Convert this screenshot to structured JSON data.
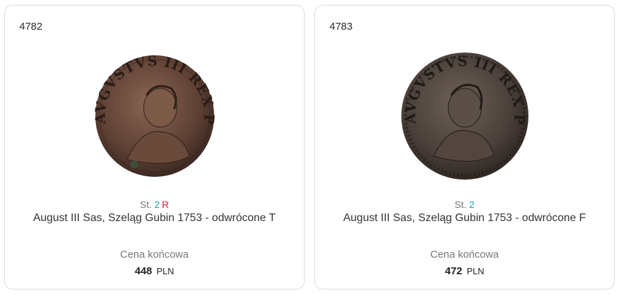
{
  "items": [
    {
      "lot": "4782",
      "grade_prefix": "St.",
      "grade_value": "2",
      "rarity": "R",
      "title": "August III Sas, Szeląg Gubin 1753 - odwrócone T",
      "price_label": "Cena końcowa",
      "price_amount": "448",
      "price_currency": "PLN",
      "coin_legend": "AVGVSTVS III REX POL",
      "coin_color": "#6b4a3a"
    },
    {
      "lot": "4783",
      "grade_prefix": "St.",
      "grade_value": "2",
      "rarity": "",
      "title": "August III Sas, Szeląg Gubin 1753 - odwrócone F",
      "price_label": "Cena końcowa",
      "price_amount": "472",
      "price_currency": "PLN",
      "coin_legend": "AVGVSTVS III REX POL",
      "coin_color": "#4e4540"
    }
  ]
}
